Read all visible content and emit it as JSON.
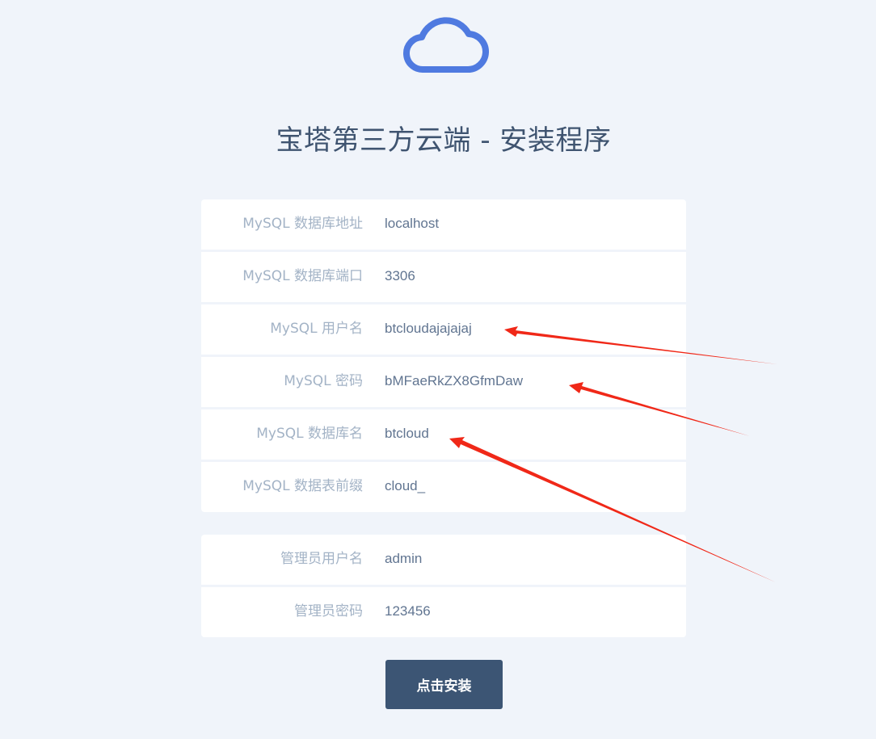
{
  "title": "宝塔第三方云端 - 安装程序",
  "logo_icon": "cloud-icon",
  "accent_color": "#4f7ae0",
  "database": {
    "fields": [
      {
        "label": "MySQL 数据库地址",
        "value": "localhost"
      },
      {
        "label": "MySQL 数据库端口",
        "value": "3306"
      },
      {
        "label": "MySQL 用户名",
        "value": "btcloudajajajaj"
      },
      {
        "label": "MySQL 密码",
        "value": "bMFaeRkZX8GfmDaw"
      },
      {
        "label": "MySQL 数据库名",
        "value": "btcloud"
      },
      {
        "label": "MySQL 数据表前缀",
        "value": "cloud_"
      }
    ]
  },
  "admin": {
    "fields": [
      {
        "label": "管理员用户名",
        "value": "admin"
      },
      {
        "label": "管理员密码",
        "value": "123456"
      }
    ]
  },
  "install_button": {
    "label": "点击安装",
    "color": "#3c5574"
  },
  "annotation_color": "#f02818"
}
